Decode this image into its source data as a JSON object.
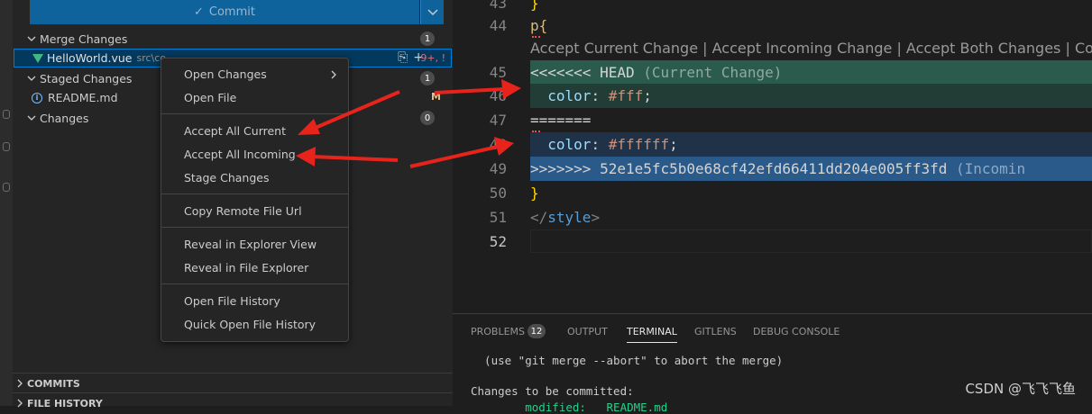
{
  "colors": {
    "accent": "#0e639c",
    "current_change": "#2b5b4c",
    "incoming_change": "#2a5a8a",
    "annotation_red": "#e8231b",
    "vue_green": "#41b883"
  },
  "sidebar": {
    "commit_label": "Commit",
    "commit_icon": "check-icon",
    "groups": {
      "merge": {
        "label": "Merge Changes",
        "count": "1"
      },
      "staged": {
        "label": "Staged Changes",
        "count": "1"
      },
      "changes": {
        "label": "Changes",
        "count": "0"
      }
    },
    "files": {
      "merge_file": {
        "name": "HelloWorld.vue",
        "path": "src\\co",
        "status": "9+, !"
      },
      "staged_file": {
        "name": "README.md",
        "status": "M"
      }
    },
    "sections": {
      "commits": "COMMITS",
      "file_history": "FILE HISTORY"
    }
  },
  "context_menu": {
    "items": [
      "Open Changes",
      "Open File",
      "Accept All Current",
      "Accept All Incoming",
      "Stage Changes",
      "Copy Remote File Url",
      "Reveal in Explorer View",
      "Reveal in File Explorer",
      "Open File History",
      "Quick Open File History"
    ]
  },
  "editor": {
    "line_numbers": [
      "43",
      "44",
      "45",
      "46",
      "47",
      "48",
      "49",
      "50",
      "51",
      "52"
    ],
    "codelens": "Accept Current Change | Accept Incoming Change | Accept Both Changes | Com",
    "lines": {
      "l43": "}",
      "l44": "p{",
      "l45a": "<<<<<<< HEAD",
      "l45b": " (Current Change)",
      "l46a": "  color",
      "l46b": ": ",
      "l46c": "#fff",
      "l46d": ";",
      "l47": "=======",
      "l48a": "  color",
      "l48b": ": ",
      "l48c": "#ffffff",
      "l48d": ";",
      "l49a": ">>>>>>> 52e1e5fc5b0e68cf42efd66411dd204e005ff3fd",
      "l49b": " (Incomin",
      "l50": "}",
      "l51a": "</",
      "l51b": "style",
      "l51c": ">",
      "l52": ""
    }
  },
  "panel": {
    "tabs": {
      "problems": "PROBLEMS",
      "problems_count": "12",
      "output": "OUTPUT",
      "terminal": "TERMINAL",
      "gitlens": "GITLENS",
      "debug": "DEBUG CONSOLE"
    },
    "terminal_lines": {
      "line1": "  (use \"git merge --abort\" to abort the merge)",
      "line2": "Changes to be committed:",
      "line3": "        modified:   README.md"
    },
    "watermark": "CSDN @飞飞飞鱼"
  }
}
